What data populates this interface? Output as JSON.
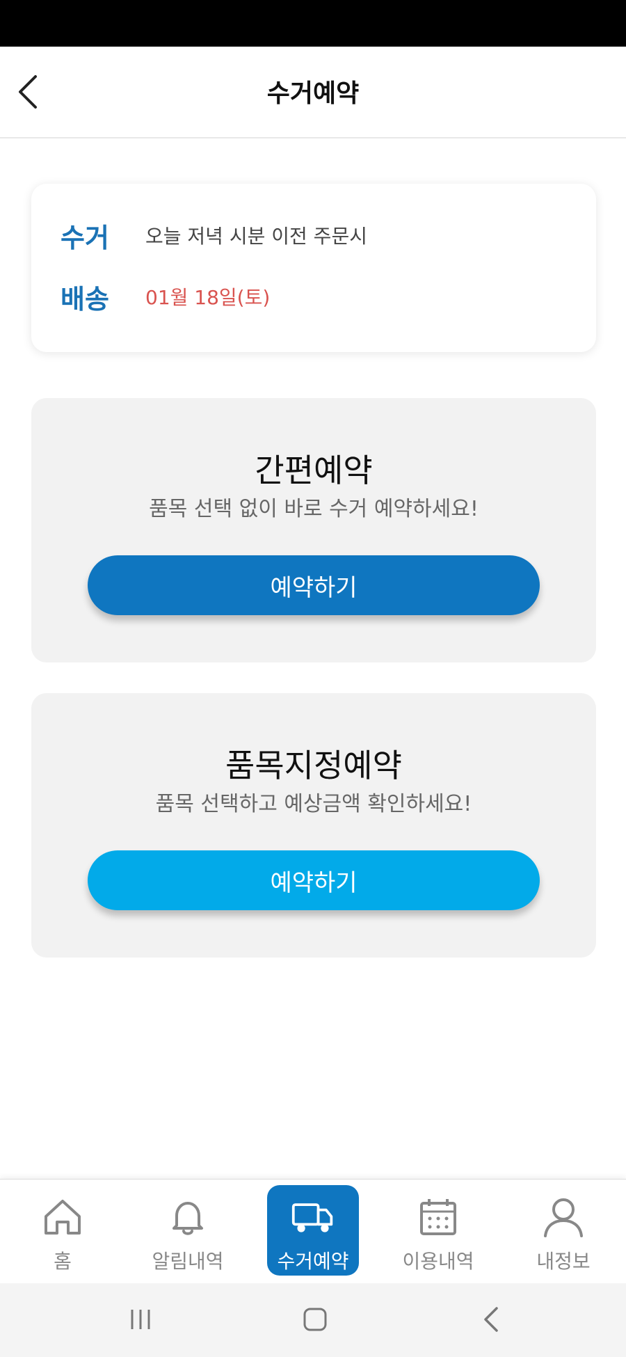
{
  "header": {
    "title": "수거예약"
  },
  "info": {
    "pickup_label": "수거",
    "pickup_value": "오늘 저녁 시분 이전 주문시",
    "delivery_label": "배송",
    "delivery_value": "01월 18일(토)"
  },
  "options": [
    {
      "title": "간편예약",
      "subtitle": "품목 선택 없이 바로 수거 예약하세요!",
      "button": "예약하기"
    },
    {
      "title": "품목지정예약",
      "subtitle": "품목 선택하고 예상금액 확인하세요!",
      "button": "예약하기"
    }
  ],
  "nav": {
    "items": [
      {
        "label": "홈",
        "icon": "home-icon"
      },
      {
        "label": "알림내역",
        "icon": "bell-icon"
      },
      {
        "label": "수거예약",
        "icon": "truck-icon",
        "active": true
      },
      {
        "label": "이용내역",
        "icon": "calendar-icon"
      },
      {
        "label": "내정보",
        "icon": "user-icon"
      }
    ]
  },
  "colors": {
    "accent": "#0f76c0",
    "accent_light": "#02aae9",
    "label_blue": "#1a72b5",
    "date_red": "#d9534f"
  }
}
